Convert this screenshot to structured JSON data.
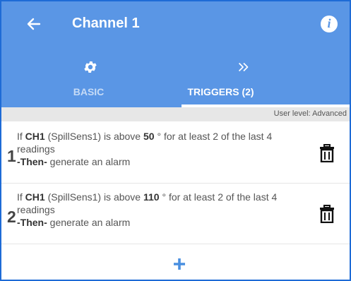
{
  "header": {
    "title": "Channel 1",
    "back_icon": "arrow-left-icon",
    "info_icon": "info-icon",
    "info_glyph": "i"
  },
  "tabs": [
    {
      "label": "BASIC",
      "icon": "gear-icon",
      "selected": false
    },
    {
      "label": "TRIGGERS (2)",
      "icon": "double-chevron-right-icon",
      "selected": true
    }
  ],
  "user_level": "User level: Advanced",
  "triggers": [
    {
      "number": "1",
      "prefix": "If ",
      "channel": "CH1",
      "mid": " (SpillSens1) is above ",
      "threshold": "50",
      "suffix": " ° for at least 2 of the last 4 readings",
      "then_label": "-Then-",
      "action": " generate an alarm"
    },
    {
      "number": "2",
      "prefix": "If ",
      "channel": "CH1",
      "mid": " (SpillSens1) is above ",
      "threshold": "110",
      "suffix": " ° for at least 2 of the last 4 readings",
      "then_label": "-Then-",
      "action": " generate an alarm"
    }
  ],
  "add_icon": "plus-icon",
  "colors": {
    "header_bg": "#5a96e5",
    "frame_border": "#1e6bd6",
    "add_icon": "#4a8fe0"
  }
}
